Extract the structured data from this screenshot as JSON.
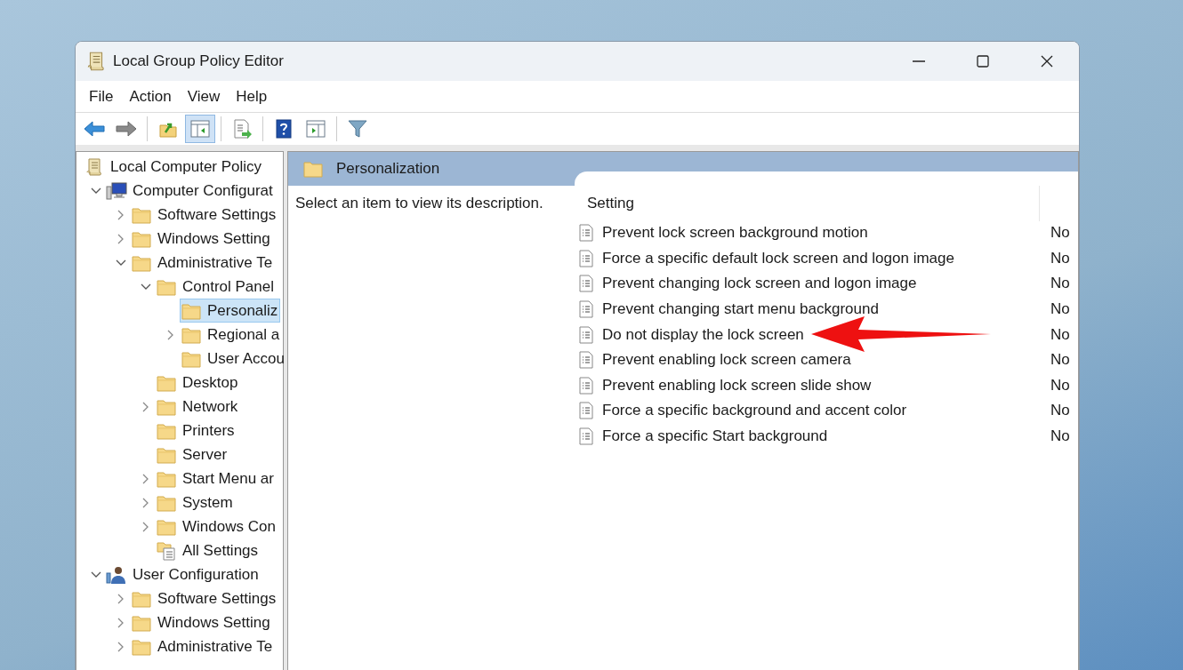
{
  "window": {
    "title": "Local Group Policy Editor"
  },
  "menu": [
    "File",
    "Action",
    "View",
    "Help"
  ],
  "toolbar": [
    [
      {
        "kind": "back",
        "pressed": false
      },
      {
        "kind": "forward",
        "pressed": false
      }
    ],
    [
      {
        "kind": "up",
        "pressed": false
      },
      {
        "kind": "tree",
        "pressed": true
      }
    ],
    [
      {
        "kind": "export",
        "pressed": false
      }
    ],
    [
      {
        "kind": "help",
        "pressed": false
      },
      {
        "kind": "action",
        "pressed": false
      }
    ],
    [
      {
        "kind": "filter",
        "pressed": false
      }
    ]
  ],
  "tree": [
    {
      "label": "Local Computer Policy",
      "kind": "policy",
      "selected": false,
      "children": [
        {
          "label": "Computer Configurat",
          "kind": "computer",
          "expanded": true,
          "selected": false,
          "children": [
            {
              "label": "Software Settings",
              "kind": "folder",
              "expanded": false,
              "selected": false
            },
            {
              "label": "Windows Setting",
              "kind": "folder",
              "expanded": false,
              "selected": false
            },
            {
              "label": "Administrative Te",
              "kind": "folder",
              "expanded": true,
              "selected": false,
              "children": [
                {
                  "label": "Control Panel",
                  "kind": "folder",
                  "expanded": true,
                  "selected": false,
                  "children": [
                    {
                      "label": "Personaliz",
                      "kind": "folder",
                      "selected": true
                    },
                    {
                      "label": "Regional a",
                      "kind": "folder",
                      "expanded": false,
                      "selected": false
                    },
                    {
                      "label": "User Accou",
                      "kind": "folder",
                      "selected": false
                    }
                  ]
                },
                {
                  "label": "Desktop",
                  "kind": "folder",
                  "selected": false
                },
                {
                  "label": "Network",
                  "kind": "folder",
                  "expanded": false,
                  "selected": false
                },
                {
                  "label": "Printers",
                  "kind": "folder",
                  "selected": false
                },
                {
                  "label": "Server",
                  "kind": "folder",
                  "selected": false
                },
                {
                  "label": "Start Menu ar",
                  "kind": "folder",
                  "expanded": false,
                  "selected": false
                },
                {
                  "label": "System",
                  "kind": "folder",
                  "expanded": false,
                  "selected": false
                },
                {
                  "label": "Windows Con",
                  "kind": "folder",
                  "expanded": false,
                  "selected": false
                },
                {
                  "label": "All Settings",
                  "kind": "settings",
                  "selected": false
                }
              ]
            }
          ]
        },
        {
          "label": "User Configuration",
          "kind": "user",
          "expanded": true,
          "selected": false,
          "children": [
            {
              "label": "Software Settings",
              "kind": "folder",
              "expanded": false,
              "selected": false
            },
            {
              "label": "Windows Setting",
              "kind": "folder",
              "expanded": false,
              "selected": false
            },
            {
              "label": "Administrative Te",
              "kind": "folder",
              "expanded": false,
              "selected": false
            }
          ]
        }
      ]
    }
  ],
  "content": {
    "header": "Personalization",
    "description": "Select an item to view its description.",
    "columns": [
      "Setting"
    ],
    "rows": [
      {
        "setting": "Prevent lock screen background motion",
        "column_2": "No"
      },
      {
        "setting": "Force a specific default lock screen and logon image",
        "column_2": "No"
      },
      {
        "setting": "Prevent changing lock screen and logon image",
        "column_2": "No"
      },
      {
        "setting": "Prevent changing start menu background",
        "column_2": "No"
      },
      {
        "setting": "Do not display the lock screen",
        "column_2": "No"
      },
      {
        "setting": "Prevent enabling lock screen camera",
        "column_2": "No"
      },
      {
        "setting": "Prevent enabling lock screen slide show",
        "column_2": "No"
      },
      {
        "setting": "Force a specific background and accent color",
        "column_2": "No"
      },
      {
        "setting": "Force a specific Start background",
        "column_2": "No"
      }
    ]
  }
}
